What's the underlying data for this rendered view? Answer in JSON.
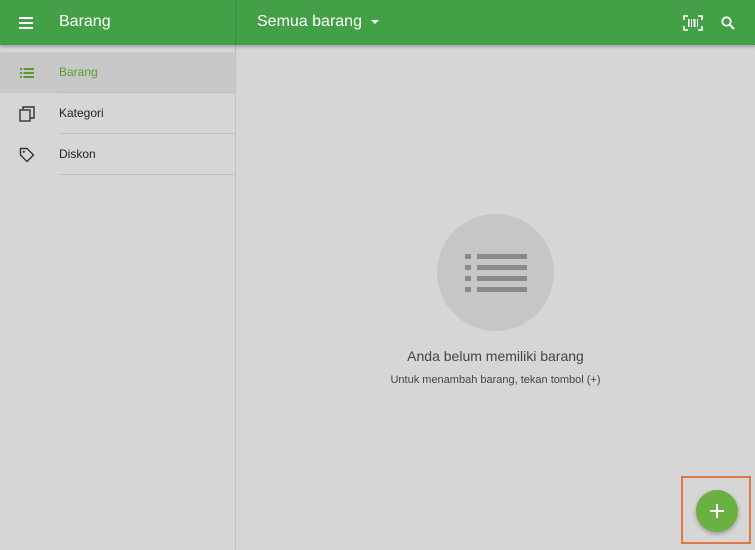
{
  "header": {
    "menu_icon": "hamburger-menu-icon",
    "title": "Barang",
    "filter_label": "Semua barang",
    "filter_icon": "dropdown-arrow-icon",
    "barcode_icon": "barcode-scan-icon",
    "search_icon": "search-icon",
    "color": "#43a047"
  },
  "sidebar": {
    "items": [
      {
        "label": "Barang",
        "icon": "list-icon",
        "active": true
      },
      {
        "label": "Kategori",
        "icon": "copy-stack-icon",
        "active": false
      },
      {
        "label": "Diskon",
        "icon": "tag-icon",
        "active": false
      }
    ],
    "active_color": "#5a9d2f"
  },
  "empty_state": {
    "icon": "list-icon",
    "title": "Anda belum memiliki barang",
    "subtitle": "Untuk menambah barang, tekan tombol (+)"
  },
  "fab": {
    "icon": "plus-icon",
    "color": "#6ab042",
    "highlight_color": "#e07a45"
  }
}
